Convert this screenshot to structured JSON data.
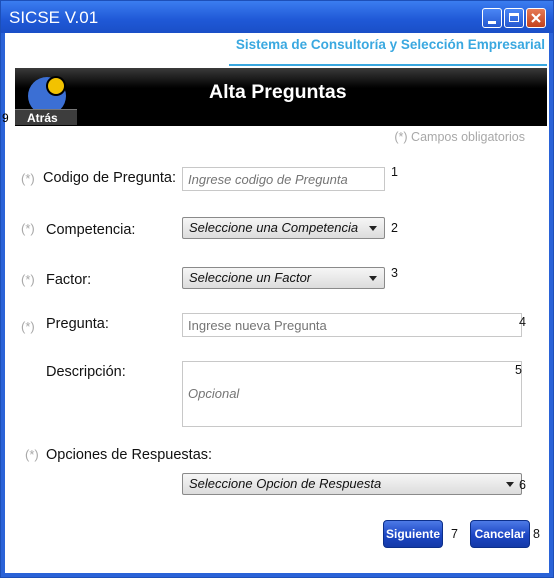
{
  "window": {
    "title": "SICSE V.01"
  },
  "header": {
    "subtitle": "Sistema de Consultoría y Selección Empresarial",
    "title": "Alta Preguntas",
    "back_label": "Atrás",
    "back_number": "9"
  },
  "form": {
    "required_note": "(*) Campos obligatorios",
    "required_marker": "(*)",
    "codigo": {
      "label": "Codigo de Pregunta:",
      "placeholder": "Ingrese codigo de Pregunta",
      "number": "1"
    },
    "competencia": {
      "label": "Competencia:",
      "value": "Seleccione una Competencia",
      "number": "2"
    },
    "factor": {
      "label": "Factor:",
      "value": "Seleccione un Factor",
      "number": "3"
    },
    "pregunta": {
      "label": "Pregunta:",
      "placeholder": "Ingrese nueva Pregunta",
      "number": "4"
    },
    "descripcion": {
      "label": "Descripción:",
      "placeholder": "Opcional",
      "number": "5"
    },
    "opciones": {
      "label": "Opciones de Respuestas:",
      "value": "Seleccione Opcion de Respuesta",
      "number": "6"
    }
  },
  "buttons": {
    "siguiente": {
      "label": "Siguiente",
      "number": "7"
    },
    "cancelar": {
      "label": "Cancelar",
      "number": "8"
    }
  },
  "colors": {
    "titlebar": "#2a63d8",
    "accent": "#3aa8e0",
    "logo_blue": "#3b6fd4",
    "logo_yellow": "#f2c200"
  }
}
